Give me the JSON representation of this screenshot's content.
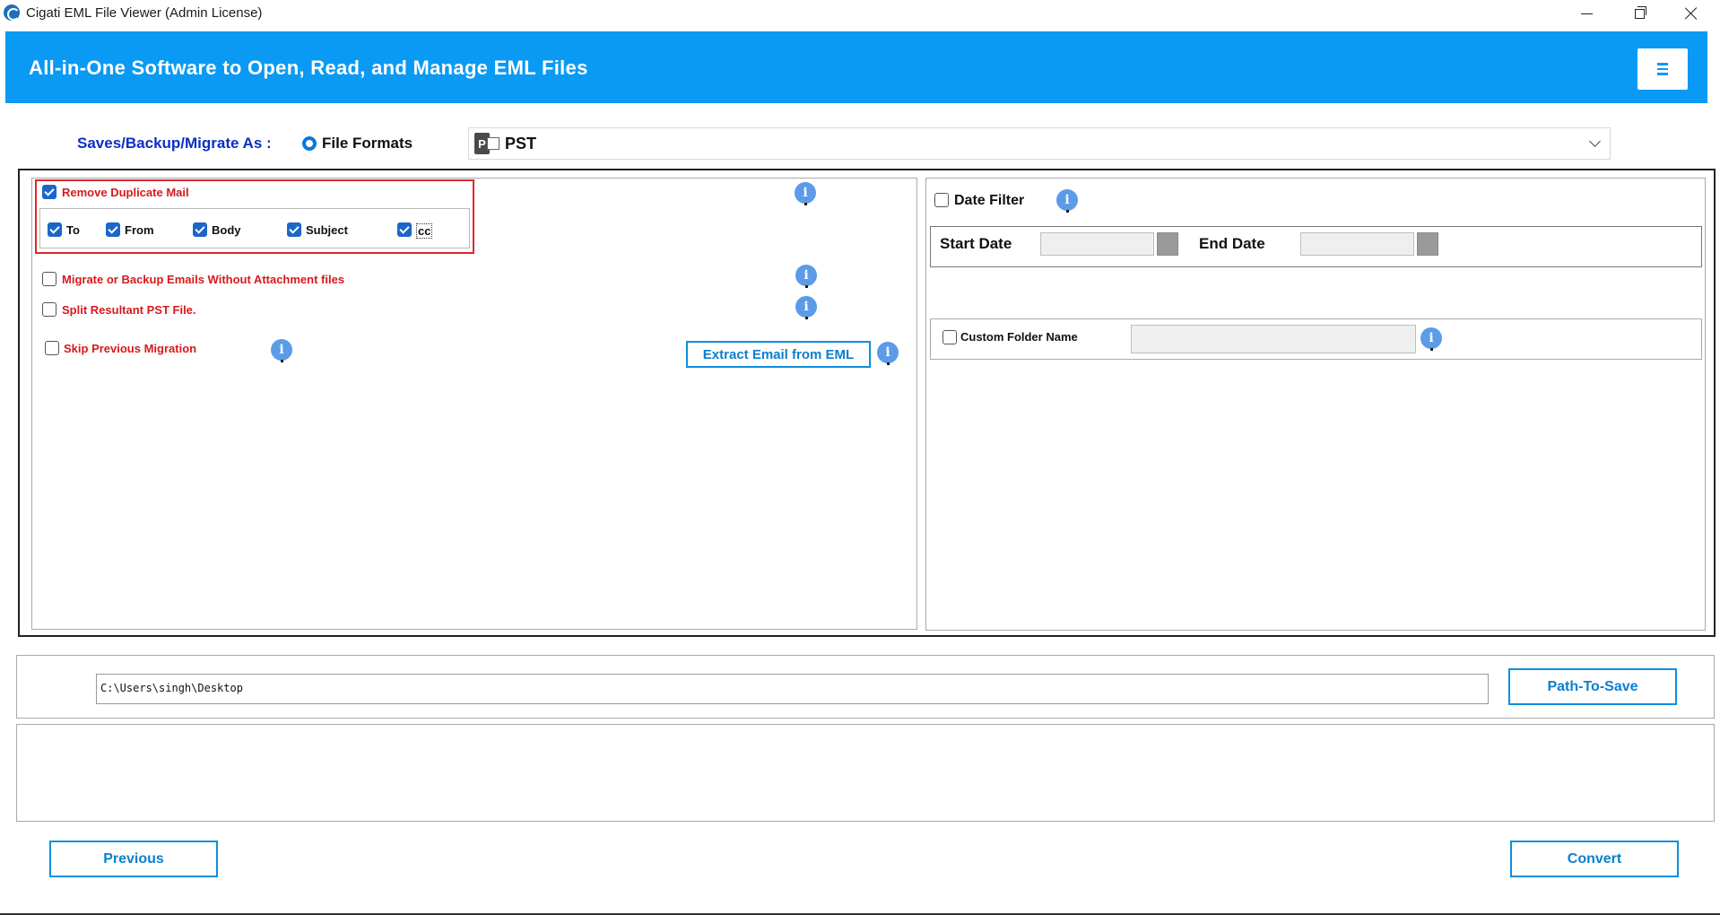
{
  "window": {
    "title": "Cigati EML File Viewer (Admin License)"
  },
  "banner": {
    "title": "All-in-One Software to Open, Read, and Manage EML Files"
  },
  "save_as": {
    "label": "Saves/Backup/Migrate As :",
    "radio_label": "File Formats",
    "selected_format": "PST"
  },
  "left_options": {
    "remove_duplicate": {
      "label": "Remove Duplicate Mail",
      "checked": true
    },
    "duplicate_fields": [
      {
        "label": "To",
        "checked": true
      },
      {
        "label": "From",
        "checked": true
      },
      {
        "label": "Body",
        "checked": true
      },
      {
        "label": "Subject",
        "checked": true
      },
      {
        "label": "cc",
        "checked": true
      }
    ],
    "without_attachments": {
      "label": "Migrate or Backup Emails Without Attachment files",
      "checked": false
    },
    "split_pst": {
      "label": "Split Resultant PST File.",
      "checked": false
    },
    "skip_previous": {
      "label": "Skip Previous Migration",
      "checked": false
    },
    "extract_button": "Extract Email from EML",
    "info_glyph": "i"
  },
  "right_options": {
    "date_filter": {
      "label": "Date Filter",
      "checked": false
    },
    "start_date_label": "Start Date",
    "end_date_label": "End Date",
    "custom_folder": {
      "label": "Custom Folder Name",
      "checked": false
    }
  },
  "path": {
    "value": "C:\\Users\\singh\\Desktop",
    "button": "Path-To-Save"
  },
  "footer": {
    "previous": "Previous",
    "convert": "Convert"
  }
}
